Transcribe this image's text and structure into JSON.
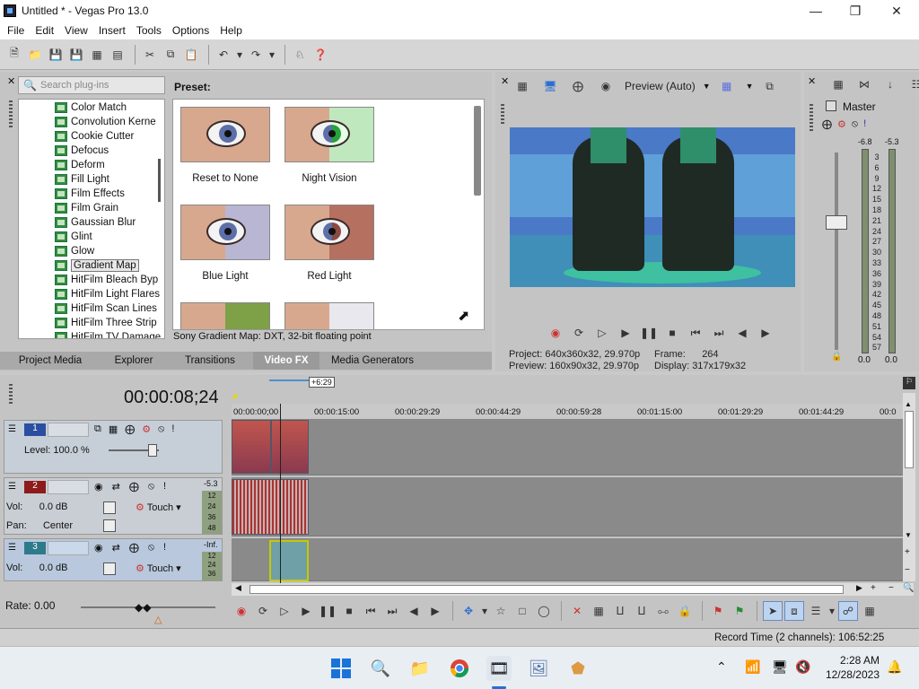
{
  "window": {
    "title": "Untitled * - Vegas Pro 13.0"
  },
  "menu": [
    "File",
    "Edit",
    "View",
    "Insert",
    "Tools",
    "Options",
    "Help"
  ],
  "plugins": {
    "search_placeholder": "Search plug-ins",
    "items": [
      "Color Match",
      "Convolution Kerne",
      "Cookie Cutter",
      "Defocus",
      "Deform",
      "Fill Light",
      "Film Effects",
      "Film Grain",
      "Gaussian Blur",
      "Glint",
      "Glow",
      "Gradient Map",
      "HitFilm Bleach Byp",
      "HitFilm Light Flares",
      "HitFilm Scan Lines",
      "HitFilm Three Strip",
      "HitFilm TV Damage"
    ],
    "selected": "Gradient Map"
  },
  "presets": {
    "label": "Preset:",
    "items": [
      "Reset to None",
      "Night Vision",
      "Blue Light",
      "Red  Light"
    ],
    "description": "Sony Gradient Map: DXT, 32-bit floating point"
  },
  "panel_tabs": [
    "Project Media",
    "Explorer",
    "Transitions",
    "Video FX",
    "Media Generators"
  ],
  "active_tab": "Video FX",
  "preview": {
    "mode": "Preview (Auto)",
    "project_label": "Project:",
    "project_value": "640x360x32, 29.970p",
    "preview_label": "Preview:",
    "preview_value": "160x90x32, 29.970p",
    "frame_label": "Frame:",
    "frame_value": "264",
    "display_label": "Display:",
    "display_value": "317x179x32"
  },
  "master": {
    "title": "Master",
    "peak_left": "-6.8",
    "peak_right": "-5.3",
    "scale": [
      "3",
      "6",
      "9",
      "12",
      "15",
      "18",
      "21",
      "24",
      "27",
      "30",
      "33",
      "36",
      "39",
      "42",
      "45",
      "48",
      "51",
      "54",
      "57"
    ],
    "bottom_left": "0.0",
    "bottom_right": "0.0"
  },
  "timeline": {
    "timecode": "00:00:08;24",
    "cursor_label": "+6:29",
    "ruler": [
      "00:00:00;00",
      "00:00:15:00",
      "00:00:29:29",
      "00:00:44:29",
      "00:00:59:28",
      "00:01:15:00",
      "00:01:29:29",
      "00:01:44:29",
      "00:0"
    ],
    "track1": {
      "num": "1",
      "level_label": "Level:",
      "level_value": "100.0 %"
    },
    "track2": {
      "num": "2",
      "vol_label": "Vol:",
      "vol_value": "0.0 dB",
      "pan_label": "Pan:",
      "pan_value": "Center",
      "mode": "Touch",
      "meter_top": "-5.3",
      "meter_scale": [
        "12",
        "24",
        "36",
        "48"
      ]
    },
    "track3": {
      "num": "3",
      "vol_label": "Vol:",
      "vol_value": "0.0 dB",
      "mode": "Touch",
      "meter_top": "-Inf.",
      "meter_scale": [
        "12",
        "24",
        "36"
      ]
    },
    "rate": "Rate: 0.00"
  },
  "status": {
    "record_time": "Record Time (2 channels): 106:52:25"
  },
  "taskbar": {
    "time": "2:28 AM",
    "date": "12/28/2023"
  }
}
